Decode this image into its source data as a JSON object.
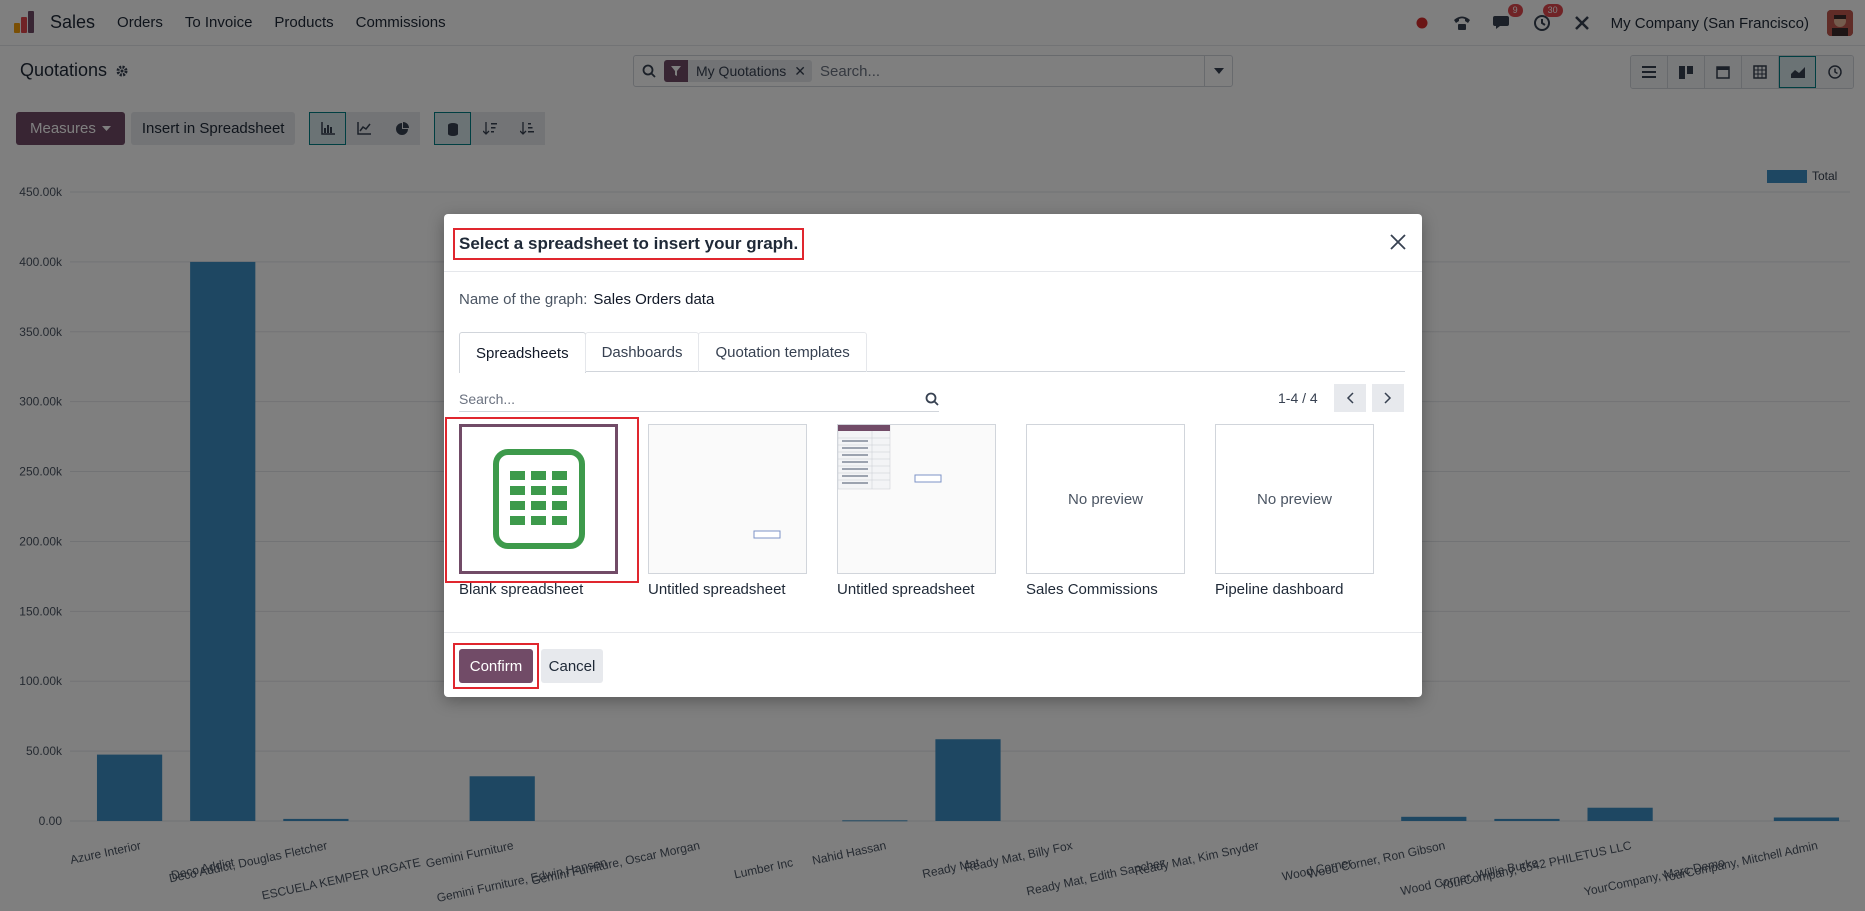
{
  "app": {
    "name": "Sales",
    "menu": [
      "Orders",
      "To Invoice",
      "Products",
      "Commissions"
    ],
    "badges": {
      "messages": "9",
      "activities": "30"
    },
    "company": "My Company (San Francisco)",
    "colors": {
      "brand": "#714b67",
      "accent": "#017e84",
      "bar": "#3c8fc4",
      "highlight": "#e0262e"
    }
  },
  "control_panel": {
    "title": "Quotations",
    "facet": "My Quotations",
    "search_placeholder": "Search...",
    "measures_label": "Measures",
    "insert_label": "Insert in Spreadsheet"
  },
  "chart_data": {
    "type": "bar",
    "title": "",
    "xlabel": "",
    "ylabel": "",
    "ylim": [
      0,
      450000
    ],
    "yticks": [
      "0.00",
      "50.00k",
      "100.00k",
      "150.00k",
      "200.00k",
      "250.00k",
      "300.00k",
      "350.00k",
      "400.00k",
      "450.00k"
    ],
    "legend": "top-right",
    "categories": [
      "Azure Interior",
      "Deco Addict",
      "Deco Addict, Douglas Fletcher",
      "ESCUELA KEMPER URGATE",
      "Gemini Furniture",
      "Gemini Furniture, Edwin Hansen",
      "Gemini Furniture, Oscar Morgan",
      "Lumber Inc",
      "Nahid Hassan",
      "Ready Mat",
      "Ready Mat, Billy Fox",
      "Ready Mat, Edith Sanchez",
      "Ready Mat, Kim Snyder",
      "Wood Corner",
      "Wood Corner, Ron Gibson",
      "Wood Corner, Willie Burke",
      "YourCompany, 6542 PHILETUS LLC",
      "YourCompany, Marc Demo",
      "YourCompany, Mitchell Admin"
    ],
    "series": [
      {
        "name": "Total",
        "values": [
          47500,
          400000,
          1500,
          0,
          32000,
          0,
          0,
          0,
          500,
          58500,
          0,
          0,
          0,
          0,
          3000,
          1500,
          9500,
          0,
          2500
        ]
      }
    ]
  },
  "modal": {
    "title": "Select a spreadsheet to insert your graph.",
    "name_label": "Name of the graph:",
    "name_value": "Sales Orders data",
    "tabs": [
      "Spreadsheets",
      "Dashboards",
      "Quotation templates"
    ],
    "search_placeholder": "Search...",
    "pager": "1-4 / 4",
    "no_preview": "No preview",
    "items": [
      {
        "label": "Blank spreadsheet"
      },
      {
        "label": "Untitled spreadsheet"
      },
      {
        "label": "Untitled spreadsheet"
      },
      {
        "label": "Sales Commissions"
      },
      {
        "label": "Pipeline dashboard"
      }
    ],
    "confirm_label": "Confirm",
    "cancel_label": "Cancel"
  }
}
